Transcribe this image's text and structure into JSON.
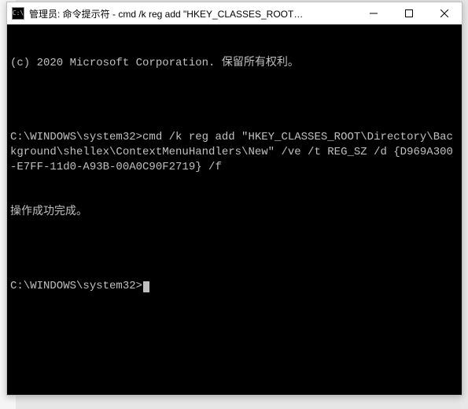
{
  "window": {
    "title": "管理员: 命令提示符 - cmd  /k reg add \"HKEY_CLASSES_ROOT\\Director...",
    "icon_label": "C:\\",
    "buttons": {
      "minimize": "minimize",
      "maximize": "maximize",
      "close": "close"
    }
  },
  "terminal": {
    "lines": [
      "(c) 2020 Microsoft Corporation. 保留所有权利。",
      "",
      "C:\\WINDOWS\\system32>cmd /k reg add \"HKEY_CLASSES_ROOT\\Directory\\Background\\shellex\\ContextMenuHandlers\\New\" /ve /t REG_SZ /d {D969A300-E7FF-11d0-A93B-00A0C90F2719} /f",
      "操作成功完成。",
      "",
      "C:\\WINDOWS\\system32>"
    ]
  }
}
